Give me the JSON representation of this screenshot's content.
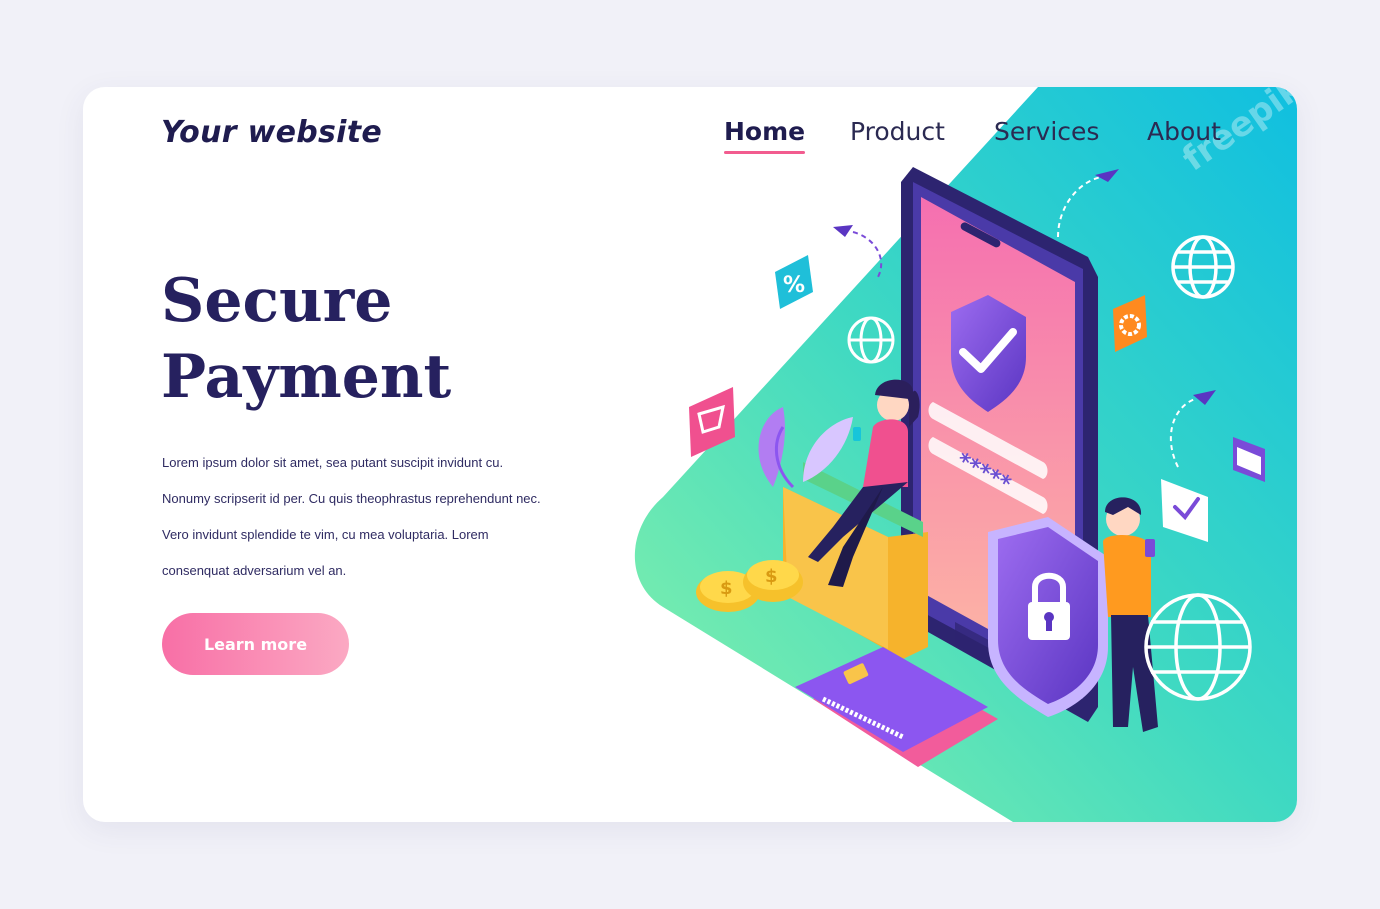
{
  "header": {
    "logo": "Your website",
    "nav": [
      {
        "label": "Home",
        "active": true
      },
      {
        "label": "Product",
        "active": false
      },
      {
        "label": "Services",
        "active": false
      },
      {
        "label": "About",
        "active": false
      }
    ]
  },
  "hero": {
    "title_line1": "Secure",
    "title_line2": "Payment",
    "description": "Lorem ipsum dolor sit amet, sea putant suscipit invidunt cu. Nonumy scripserit id per. Cu quis theophrastus reprehendunt nec. Vero invidunt splendide te vim, cu mea voluptaria. Lorem consenquat adversarium vel an.",
    "cta_label": "Learn more"
  },
  "illustration": {
    "percent_symbol": "%",
    "password_mask": "*****",
    "card_symbol": "$",
    "watermark": "freepik"
  },
  "colors": {
    "accent_pink": "#f25c8f",
    "navy": "#26215f",
    "gradient_teal": "#1fc8d6",
    "gradient_green": "#7ff0a8",
    "purple": "#7a4bd8"
  }
}
